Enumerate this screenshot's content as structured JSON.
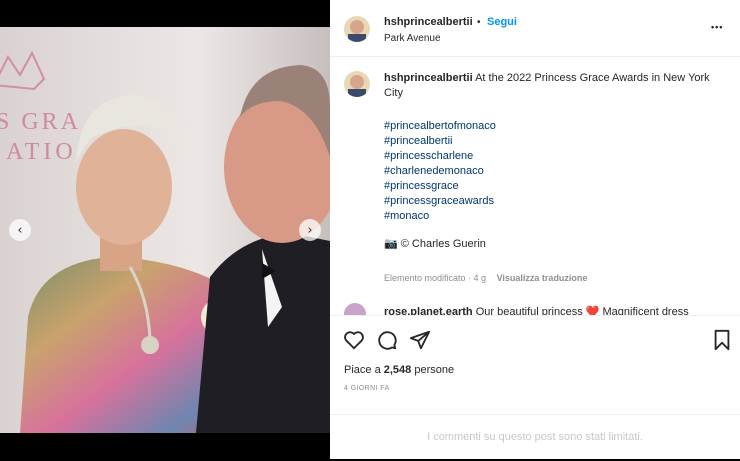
{
  "post": {
    "username": "hshprincealbertii",
    "follow_label": "Segui",
    "separator": "•",
    "location": "Park Avenue",
    "more_label": "•••",
    "caption": "At the 2022 Princess Grace Awards in New York City",
    "hashtags": [
      "#princealbertofmonaco",
      "#princealbertii",
      "#princesscharlene",
      "#charlenedemonaco",
      "#princessgrace",
      "#princessgraceawards",
      "#monaco"
    ],
    "credit": "📷 © Charles Guerin",
    "edited_label": "Elemento modificato · 4 g",
    "translate_label": "Visualizza traduzione"
  },
  "comment": {
    "username": "rose.planet.earth",
    "text": "Our beautiful princess ❤️ Magnificent dress"
  },
  "likes": {
    "prefix": "Piace a ",
    "count": "2,548",
    "suffix": " persone"
  },
  "date": "4 GIORNI FA",
  "comments_limited": "I commenti su questo post sono stati limitati.",
  "photo": {
    "backdrop_text_1": "S GRA",
    "backdrop_text_2": "ATIO"
  },
  "colors": {
    "accent": "#0095f6",
    "hashtag": "#00376b",
    "muted": "#8e8e8e"
  },
  "icons": [
    "heart-icon",
    "comment-icon",
    "share-icon",
    "bookmark-icon",
    "chevron-left-icon",
    "chevron-right-icon",
    "camera-icon"
  ]
}
